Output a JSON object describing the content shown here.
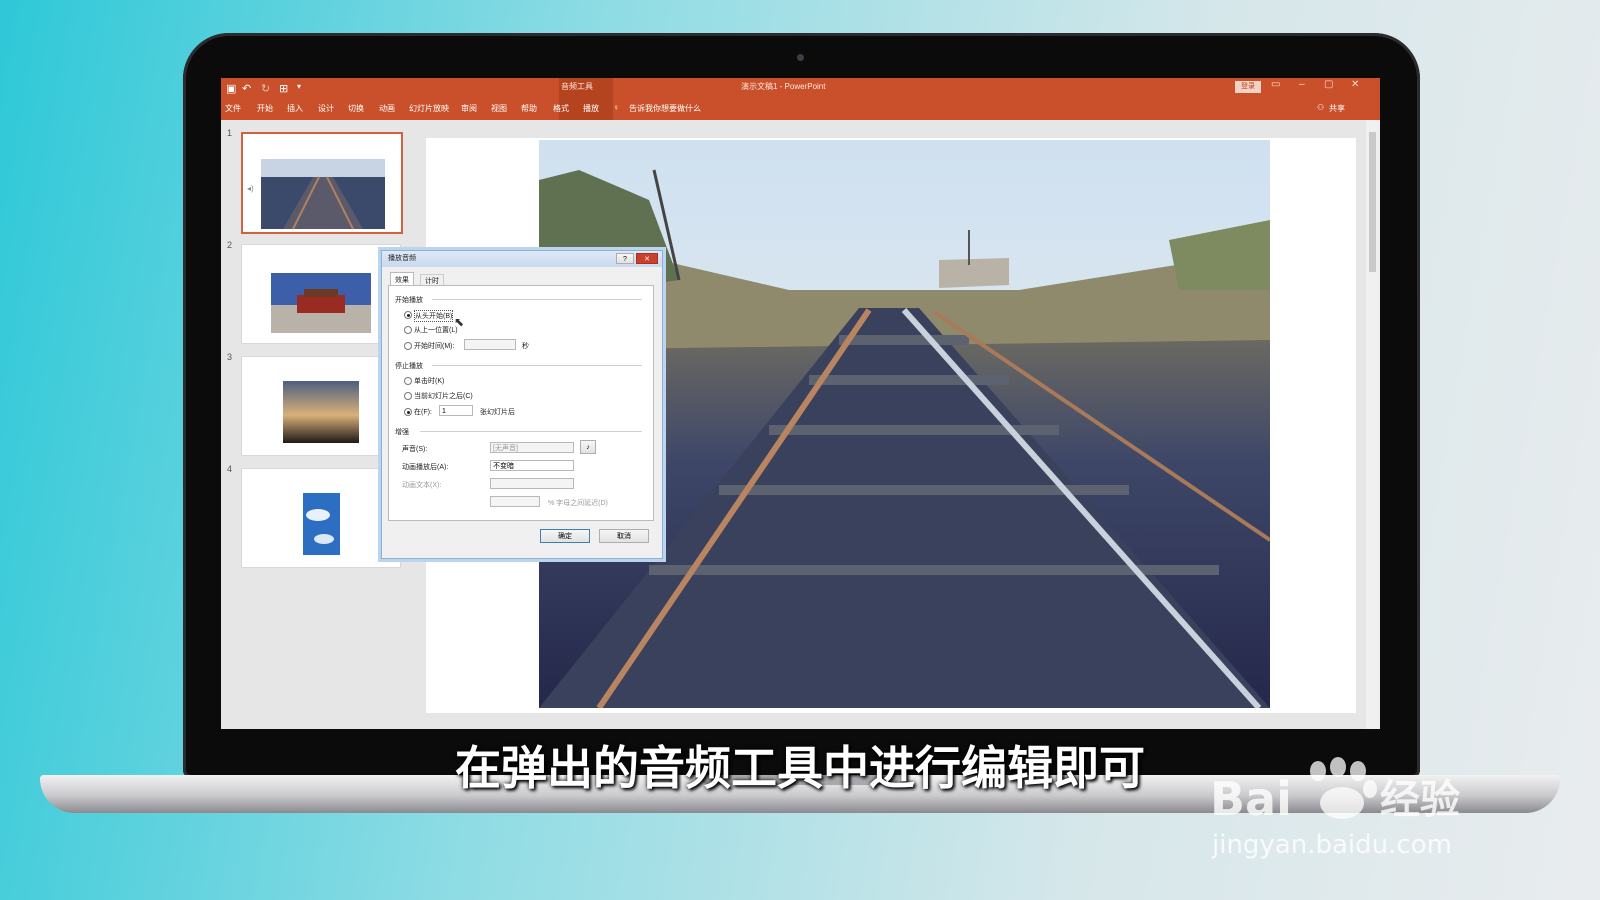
{
  "window": {
    "title": "演示文稿1 - PowerPoint",
    "contextual_tab": "音频工具",
    "login_button": "登录",
    "share": "共享",
    "tell_me": "告诉我你想要做什么"
  },
  "ribbon_tabs": [
    "文件",
    "开始",
    "插入",
    "设计",
    "切换",
    "动画",
    "幻灯片放映",
    "审阅",
    "视图",
    "帮助",
    "格式",
    "播放"
  ],
  "thumbnails": [
    {
      "number": "1",
      "scene": "railway"
    },
    {
      "number": "2",
      "scene": "tiananmen"
    },
    {
      "number": "3",
      "scene": "sunset-clouds"
    },
    {
      "number": "4",
      "scene": "blue-sky"
    }
  ],
  "dialog": {
    "title": "播放音频",
    "help_button": "?",
    "close_button": "✕",
    "tabs": [
      "效果",
      "计时"
    ],
    "start_group": "开始播放",
    "start_from_beginning": "从头开始(B)",
    "start_from_last": "从上一位置(L)",
    "start_time": "开始时间(M):",
    "seconds_unit": "秒",
    "stop_group": "停止播放",
    "stop_on_click": "单击时(K)",
    "stop_after_current": "当前幻灯片之后(C)",
    "stop_after": "在(F):",
    "stop_after_value": "1",
    "slides_after": "张幻灯片后",
    "enhance_group": "增强",
    "sound_label": "声音(S):",
    "sound_value": "[无声音]",
    "after_animation_label": "动画播放后(A):",
    "after_animation_value": "不变暗",
    "animate_text_label": "动画文本(X):",
    "letter_delay_label": "% 字母之间延迟(D)",
    "ok_button": "确定",
    "cancel_button": "取消"
  },
  "caption": "在弹出的音频工具中进行编辑即可",
  "watermark": {
    "brand": "Bai",
    "brand_suffix": "经验",
    "url": "jingyan.baidu.com"
  },
  "colors": {
    "accent": "#c9502b",
    "background": "#2ec8d8"
  }
}
